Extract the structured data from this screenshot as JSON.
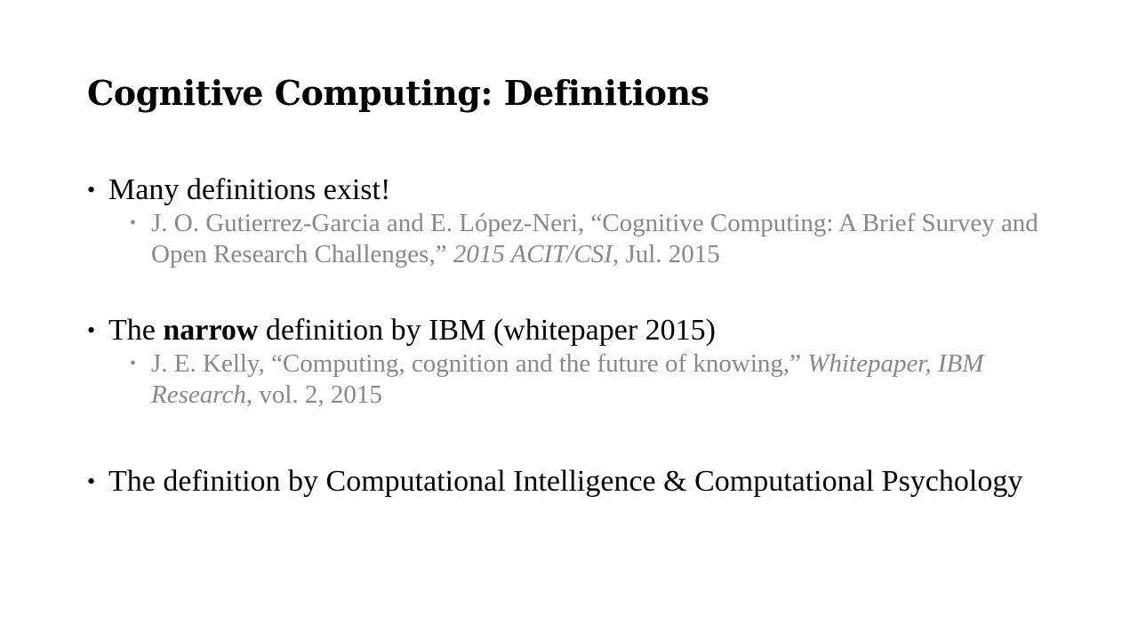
{
  "title": "Cognitive Computing: Definitions",
  "bullets": [
    {
      "text": "Many definitions exist!",
      "sub": {
        "text_a": "J. O. Gutierrez-Garcia and E. López-Neri, “Cognitive Computing: A Brief Survey and Open Research Challenges,” ",
        "italic": "2015 ACIT/CSI",
        "text_b": ", Jul. 2015"
      }
    },
    {
      "text_before": "The ",
      "bold": "narrow",
      "text_after": " definition by IBM (whitepaper 2015)",
      "sub": {
        "text_a": "J. E. Kelly, “Computing, cognition and the future of knowing,” ",
        "italic": "Whitepaper, IBM Research",
        "text_b": ", vol. 2, 2015"
      }
    },
    {
      "text": "The definition by Computational Intelligence & Computational Psychology"
    }
  ]
}
